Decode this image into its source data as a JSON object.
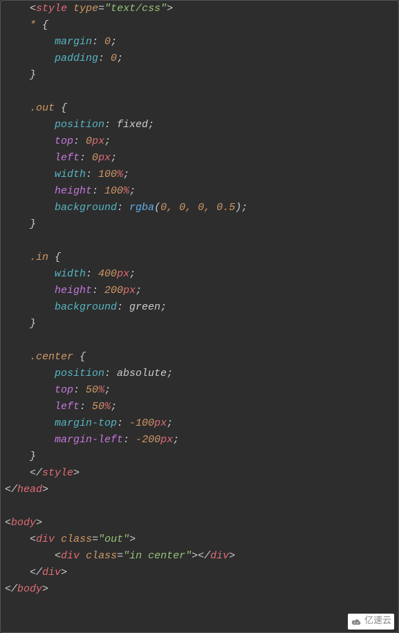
{
  "code": {
    "tag_style_open": "style",
    "attr_type": "type",
    "val_textcss": "\"text/css\"",
    "sel_star": "*",
    "brace_open": "{",
    "brace_close": "}",
    "prop_margin": "margin",
    "zero": "0",
    "prop_padding": "padding",
    "sel_out": ".out",
    "prop_position": "position",
    "kw_fixed": "fixed",
    "prop_top": "top",
    "val_0px_num": "0",
    "unit_px": "px",
    "prop_left": "left",
    "prop_width": "width",
    "val_100": "100",
    "unit_pct": "%",
    "prop_height": "height",
    "prop_background": "background",
    "func_rgba": "rgba",
    "rgba_args": "0, 0, 0, 0.5",
    "sel_in": ".in",
    "val_400": "400",
    "val_200": "200",
    "kw_green": "green",
    "sel_center": ".center",
    "kw_absolute": "absolute",
    "val_50": "50",
    "prop_margin_top": "margin-top",
    "val_neg100": "-100",
    "prop_margin_left": "margin-left",
    "val_neg200": "-200",
    "tag_style_close": "style",
    "tag_head": "head",
    "tag_body": "body",
    "tag_div": "div",
    "attr_class": "class",
    "val_out": "\"out\"",
    "val_in_center": "\"in center\""
  },
  "watermark": "亿速云"
}
